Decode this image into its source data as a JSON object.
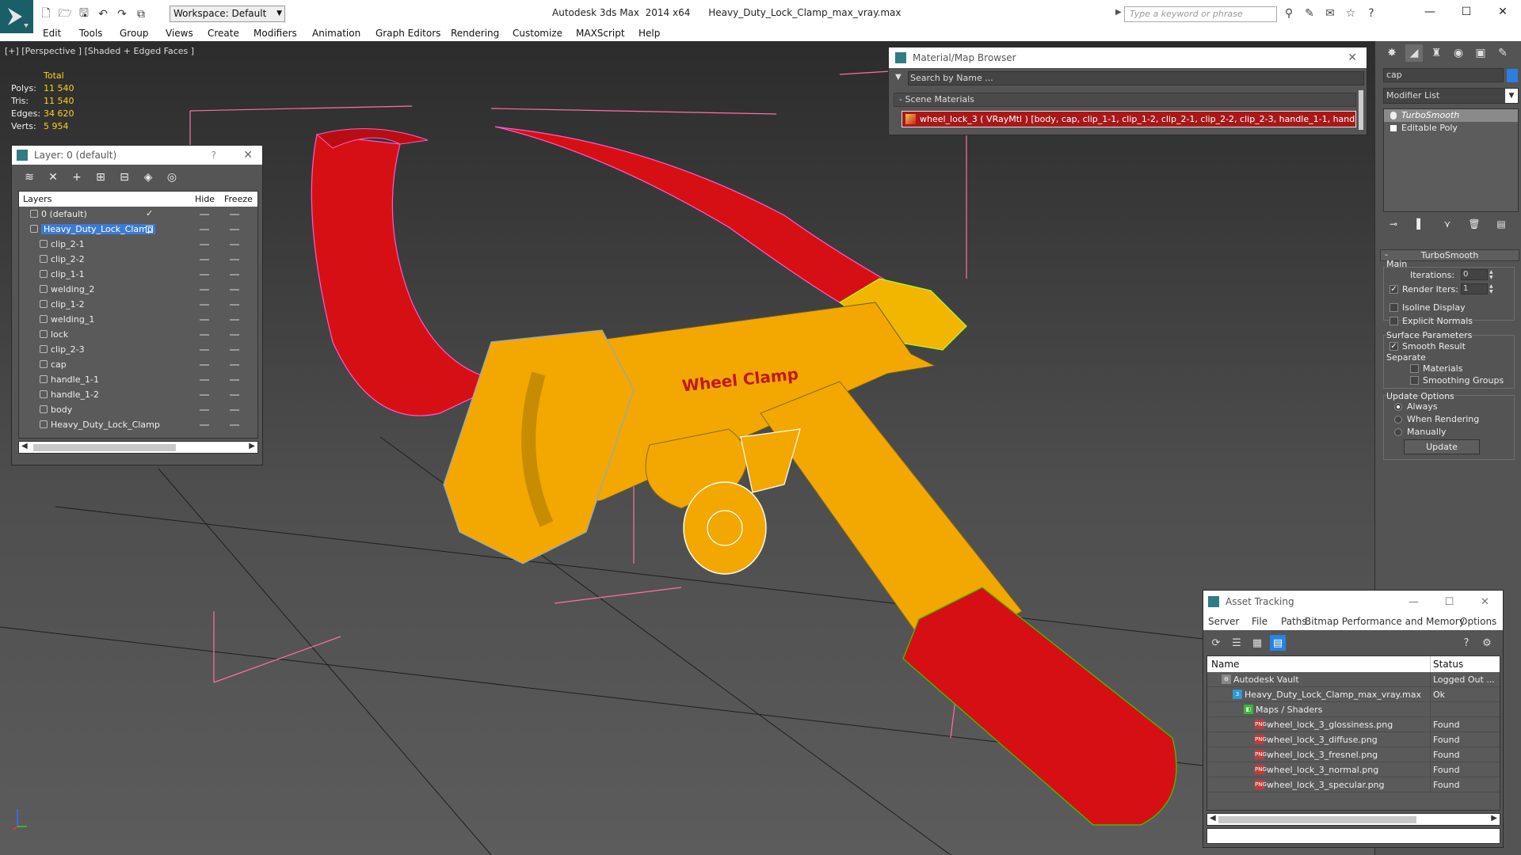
{
  "app": {
    "title": "Autodesk 3ds Max  2014 x64      Heavy_Duty_Lock_Clamp_max_vray.max",
    "workspace": "Workspace: Default",
    "search_placeholder": "Type a keyword or phrase"
  },
  "menu": [
    "Edit",
    "Tools",
    "Group",
    "Views",
    "Create",
    "Modifiers",
    "Animation",
    "Graph Editors",
    "Rendering",
    "Customize",
    "MAXScript",
    "Help"
  ],
  "viewport": {
    "label": "[+] [Perspective ] [Shaded + Edged Faces ]",
    "model_text": "Wheel Clamp",
    "stats": {
      "header": "Total",
      "rows": [
        {
          "k": "Polys:",
          "v": "11 540"
        },
        {
          "k": "Tris:",
          "v": "11 540"
        },
        {
          "k": "Edges:",
          "v": "34 620"
        },
        {
          "k": "Verts:",
          "v": "5 954"
        }
      ]
    }
  },
  "layer_panel": {
    "title": "Layer: 0 (default)",
    "help": "?",
    "columns": {
      "layers": "Layers",
      "hide": "Hide",
      "freeze": "Freeze"
    },
    "rows": [
      {
        "name": "0 (default)",
        "level": 0,
        "current": true
      },
      {
        "name": "Heavy_Duty_Lock_Clamp",
        "level": 0,
        "selected": true
      },
      {
        "name": "clip_2-1",
        "level": 1
      },
      {
        "name": "clip_2-2",
        "level": 1
      },
      {
        "name": "clip_1-1",
        "level": 1
      },
      {
        "name": "welding_2",
        "level": 1
      },
      {
        "name": "clip_1-2",
        "level": 1
      },
      {
        "name": "welding_1",
        "level": 1
      },
      {
        "name": "lock",
        "level": 1
      },
      {
        "name": "clip_2-3",
        "level": 1
      },
      {
        "name": "cap",
        "level": 1
      },
      {
        "name": "handle_1-1",
        "level": 1
      },
      {
        "name": "handle_1-2",
        "level": 1
      },
      {
        "name": "body",
        "level": 1
      },
      {
        "name": "Heavy_Duty_Lock_Clamp",
        "level": 1
      }
    ]
  },
  "material_browser": {
    "title": "Material/Map Browser",
    "search": "Search by Name ...",
    "section": "- Scene Materials",
    "material": "wheel_lock_3  ( VRayMtl )  [body, cap, clip_1-1, clip_1-2, clip_2-1, clip_2-2, clip_2-3, handle_1-1, handle_..."
  },
  "command_panel": {
    "object_name": "cap",
    "object_color": "#2a7fe0",
    "modifier_list": "Modifier List",
    "stack": [
      {
        "name": "TurboSmooth",
        "active": true
      },
      {
        "name": "Editable Poly",
        "active": false
      }
    ],
    "turbosmooth": {
      "title": "TurboSmooth",
      "main": "Main",
      "iterations_label": "Iterations:",
      "iterations": "0",
      "render_iters_label": "Render Iters:",
      "render_iters": "1",
      "isoline": "Isoline Display",
      "explicit_normals": "Explicit Normals",
      "surface_params": "Surface Parameters",
      "smooth_result": "Smooth Result",
      "separate": "Separate",
      "materials": "Materials",
      "smoothing_groups": "Smoothing Groups",
      "update_options": "Update Options",
      "always": "Always",
      "when_rendering": "When Rendering",
      "manually": "Manually",
      "update": "Update"
    }
  },
  "asset_tracking": {
    "title": "Asset Tracking",
    "menu": [
      "Server",
      "File",
      "Paths",
      "Bitmap Performance and Memory",
      "Options"
    ],
    "columns": {
      "name": "Name",
      "status": "Status"
    },
    "rows": [
      {
        "name": "Autodesk Vault",
        "status": "Logged Out ...",
        "indent": 1,
        "icon": "vault"
      },
      {
        "name": "Heavy_Duty_Lock_Clamp_max_vray.max",
        "status": "Ok",
        "indent": 2,
        "icon": "max"
      },
      {
        "name": "Maps / Shaders",
        "status": "",
        "indent": 3,
        "icon": "maps"
      },
      {
        "name": "wheel_lock_3_glossiness.png",
        "status": "Found",
        "indent": 4,
        "icon": "png"
      },
      {
        "name": "wheel_lock_3_diffuse.png",
        "status": "Found",
        "indent": 4,
        "icon": "png"
      },
      {
        "name": "wheel_lock_3_fresnel.png",
        "status": "Found",
        "indent": 4,
        "icon": "png"
      },
      {
        "name": "wheel_lock_3_normal.png",
        "status": "Found",
        "indent": 4,
        "icon": "png"
      },
      {
        "name": "wheel_lock_3_specular.png",
        "status": "Found",
        "indent": 4,
        "icon": "png"
      }
    ]
  },
  "colors": {
    "clamp_red": "#d60f14",
    "body_yellow": "#f2a800",
    "selection_blue": "#3a7bd5"
  }
}
